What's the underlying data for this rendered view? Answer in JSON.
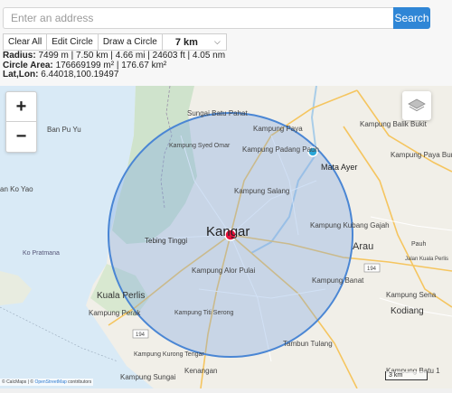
{
  "search": {
    "placeholder": "Enter an address",
    "button_label": "Search"
  },
  "toolbar": {
    "clear_all": "Clear All",
    "edit_circle": "Edit Circle",
    "draw_circle": "Draw a Circle",
    "radius_value": "7 km"
  },
  "info": {
    "radius_label": "Radius:",
    "radius_value": "7499 m | 7.50 km | 4.66 mi | 24603 ft | 4.05 nm",
    "area_label": "Circle Area:",
    "area_value": "176669199 m² | 176.67 km²",
    "latlon_label": "Lat,Lon:",
    "latlon_value": "6.44018,100.19497"
  },
  "map": {
    "zoom_in": "+",
    "zoom_out": "−",
    "attribution_prefix": "© CalcMaps | © ",
    "attribution_link": "OpenStreetMap",
    "attribution_suffix": " contributors",
    "scale_label": "3 km",
    "places": {
      "ban_pu_yu": "Ban Pu Yu",
      "sungai_batu_pahat": "Sungai Batu Pahat",
      "kampung_paya": "Kampung Paya",
      "kampung_balik_bukit": "Kampung Balik Bukit",
      "kampung_syed_omar": "Kampung Syed Omar",
      "kampung_padang_pauh": "Kampung Padang Pauh",
      "mata_ayer": "Mata Ayer",
      "kampung_paya_burma": "Kampung Paya Burma",
      "an_ko_yao": "an Ko Yao",
      "kampung_salang": "Kampung Salang",
      "tebing_tinggi": "Tebing Tinggi",
      "kangar": "Kangar",
      "kampung_kubang_gajah": "Kampung Kubang Gajah",
      "arau": "Arau",
      "pauh": "Pauh",
      "jalan_kuala_perlis": "Jalan Kuala Perlis",
      "ko_pratmana": "Ko Pratmana",
      "kampung_alor_pulai": "Kampung Alor Pulai",
      "kampung_banat": "Kampung Banat",
      "kuala_perlis": "Kuala Perlis",
      "kampung_perak": "Kampung Perak",
      "kampung_titi_serong": "Kampung Titi Serong",
      "kampung_sena": "Kampung Sena",
      "kodiang": "Kodiang",
      "tambun_tulang": "Tambun Tulang",
      "kampung_kurong_tengar": "Kampung Kurong Tengar",
      "kampung_sungai": "Kampung Sungai",
      "kenangan": "Kenangan",
      "kampung_batu_1": "Kampung Batu 1",
      "road_194": "194"
    }
  },
  "colors": {
    "accent": "#2f86d6",
    "circle_fill": "#7aa7e3",
    "circle_stroke": "#4a86d4",
    "center_marker": "#e8123c",
    "edge_marker": "#2aa7d8"
  }
}
